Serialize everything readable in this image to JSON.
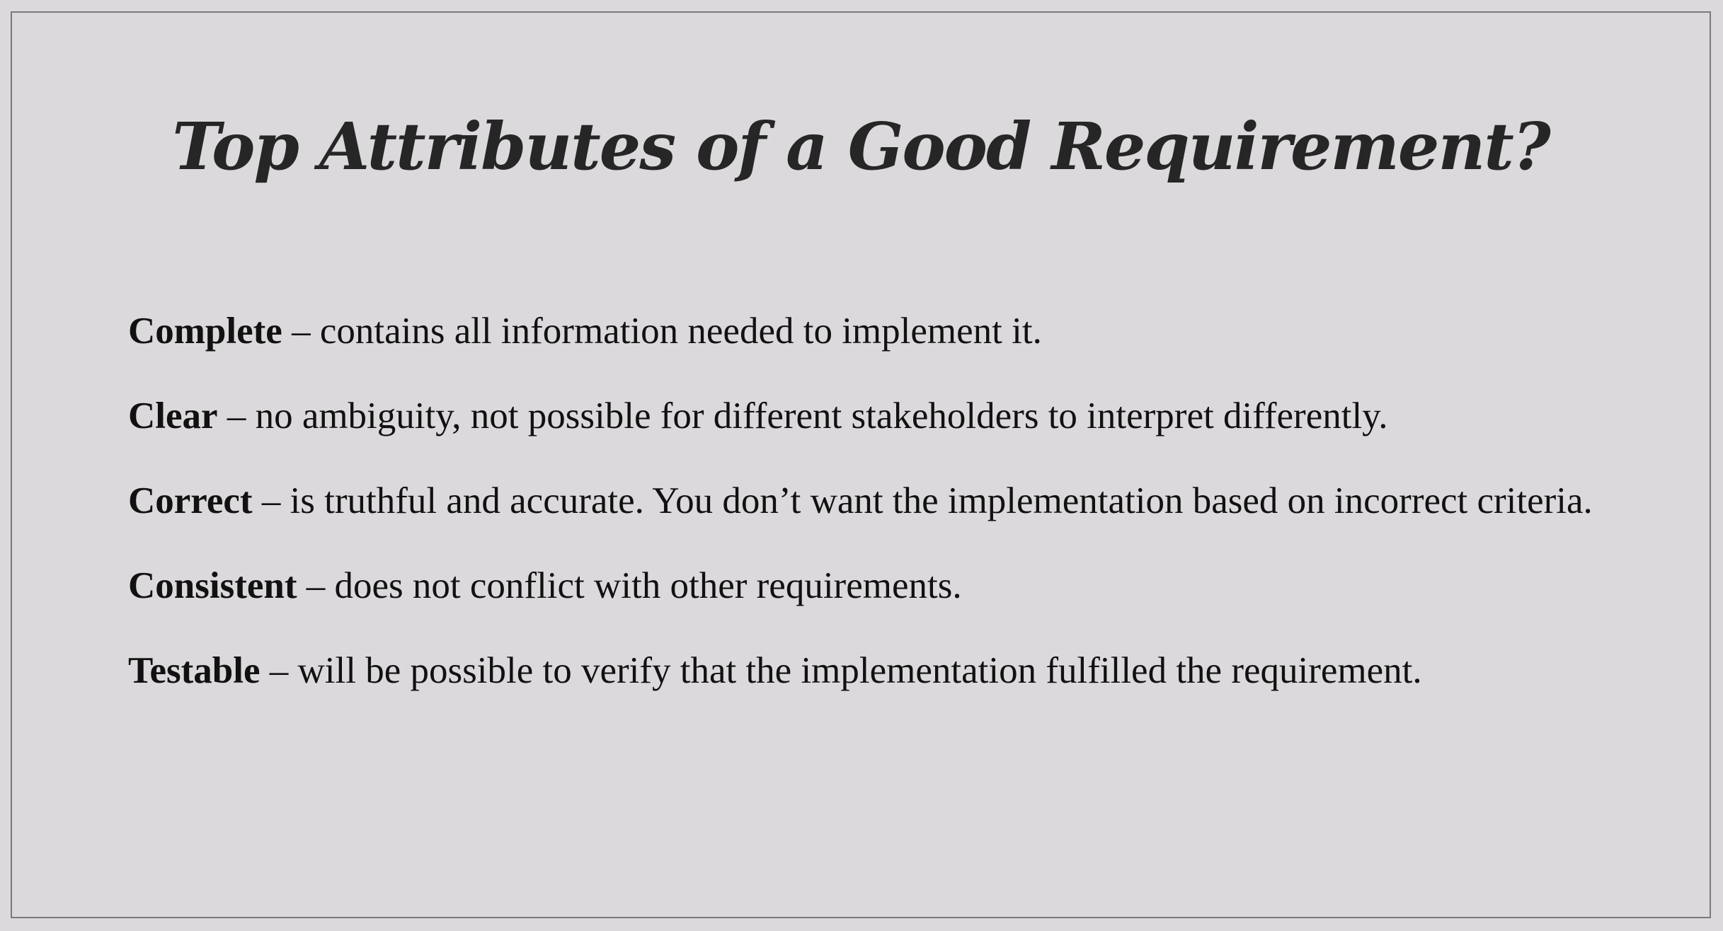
{
  "slide": {
    "title": "Top Attributes of a Good Requirement?",
    "items": [
      {
        "term": "Complete",
        "text": " – contains all information needed to implement it."
      },
      {
        "term": "Clear",
        "text": " – no ambiguity, not possible for different stakeholders to interpret differently."
      },
      {
        "term": "Correct",
        "text": " – is truthful and accurate.  You don’t want the implementation based on incorrect criteria."
      },
      {
        "term": "Consistent",
        "text": " – does not conflict with other requirements."
      },
      {
        "term": "Testable",
        "text": " – will be possible to verify that the implementation fulfilled the requirement."
      }
    ]
  },
  "colors": {
    "background": "#dcd9dc",
    "title": "#262626",
    "text": "#111111",
    "border": "#7a7a7a"
  }
}
